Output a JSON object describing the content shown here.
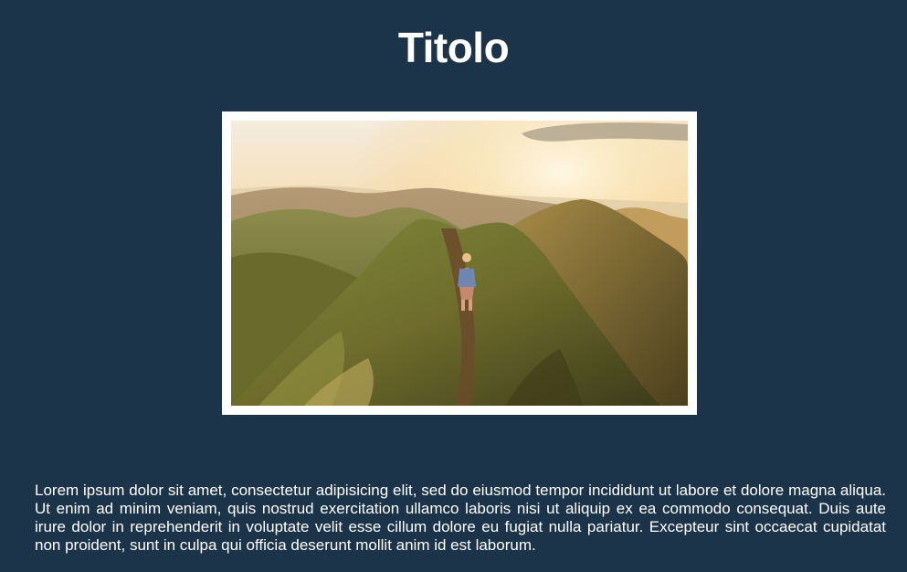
{
  "header": {
    "title": "Titolo"
  },
  "image": {
    "description_icon": "landscape-photo"
  },
  "content": {
    "paragraph": "Lorem ipsum dolor sit amet, consectetur adipisicing elit, sed do eiusmod tempor incididunt ut labore et dolore magna aliqua. Ut enim ad minim veniam, quis nostrud exercitation ullamco laboris nisi ut aliquip ex ea commodo consequat. Duis aute irure dolor in reprehenderit in voluptate velit esse cillum dolore eu fugiat nulla pariatur. Excepteur sint occaecat cupidatat non proident, sunt in culpa qui officia deserunt mollit anim id est laborum."
  },
  "colors": {
    "background": "#1b3449",
    "text": "#ffffff",
    "frame": "#ffffff"
  }
}
